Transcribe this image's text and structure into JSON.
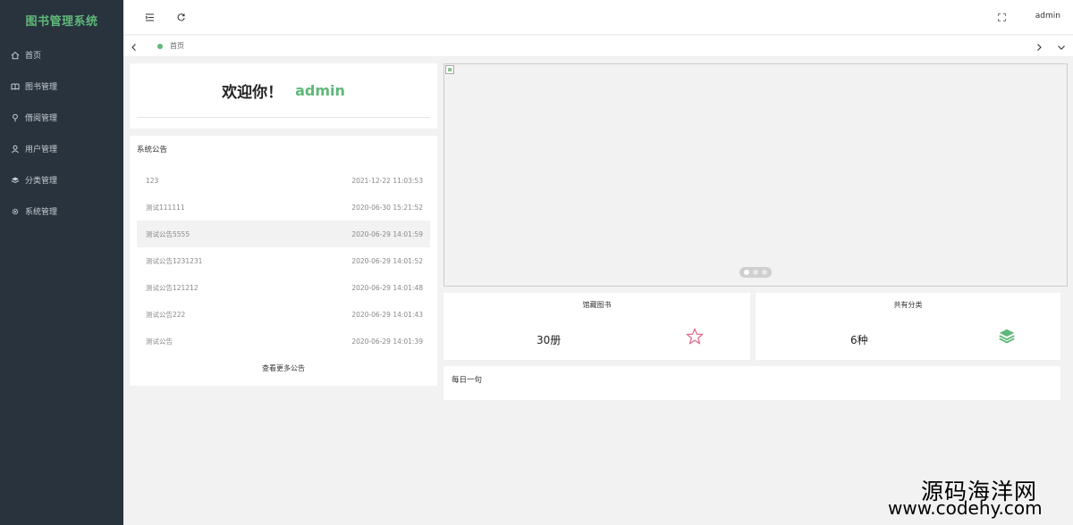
{
  "app": {
    "title": "图书管理系统"
  },
  "sidebar": {
    "items": [
      {
        "label": "首页",
        "icon": "home-icon"
      },
      {
        "label": "图书管理",
        "icon": "book-icon"
      },
      {
        "label": "借阅管理",
        "icon": "pin-icon"
      },
      {
        "label": "用户管理",
        "icon": "user-icon"
      },
      {
        "label": "分类管理",
        "icon": "layers-icon"
      },
      {
        "label": "系统管理",
        "icon": "gear-icon"
      }
    ]
  },
  "header": {
    "user": "admin"
  },
  "tabs": {
    "home": "首页"
  },
  "welcome": {
    "text": "欢迎你！",
    "user": "admin"
  },
  "notices": {
    "title": "系统公告",
    "items": [
      {
        "title": "123",
        "time": "2021-12-22 11:03:53"
      },
      {
        "title": "测试111111",
        "time": "2020-06-30 15:21:52"
      },
      {
        "title": "测试公告5555",
        "time": "2020-06-29 14:01:59"
      },
      {
        "title": "测试公告1231231",
        "time": "2020-06-29 14:01:52"
      },
      {
        "title": "测试公告121212",
        "time": "2020-06-29 14:01:48"
      },
      {
        "title": "测试公告222",
        "time": "2020-06-29 14:01:43"
      },
      {
        "title": "测试公告",
        "time": "2020-06-29 14:01:39"
      }
    ],
    "more": "查看更多公告"
  },
  "stats": {
    "books": {
      "label": "馆藏图书",
      "value": "30册",
      "icon": "star-icon",
      "color": "#e06c8c"
    },
    "categories": {
      "label": "共有分类",
      "value": "6种",
      "icon": "layers-icon",
      "color": "#5fb878"
    }
  },
  "quote": {
    "title": "每日一句"
  },
  "colors": {
    "accent": "#5fb878",
    "sidebar": "#28333e"
  },
  "watermark": {
    "name": "源码海洋网",
    "url": "www.codehy.com"
  }
}
